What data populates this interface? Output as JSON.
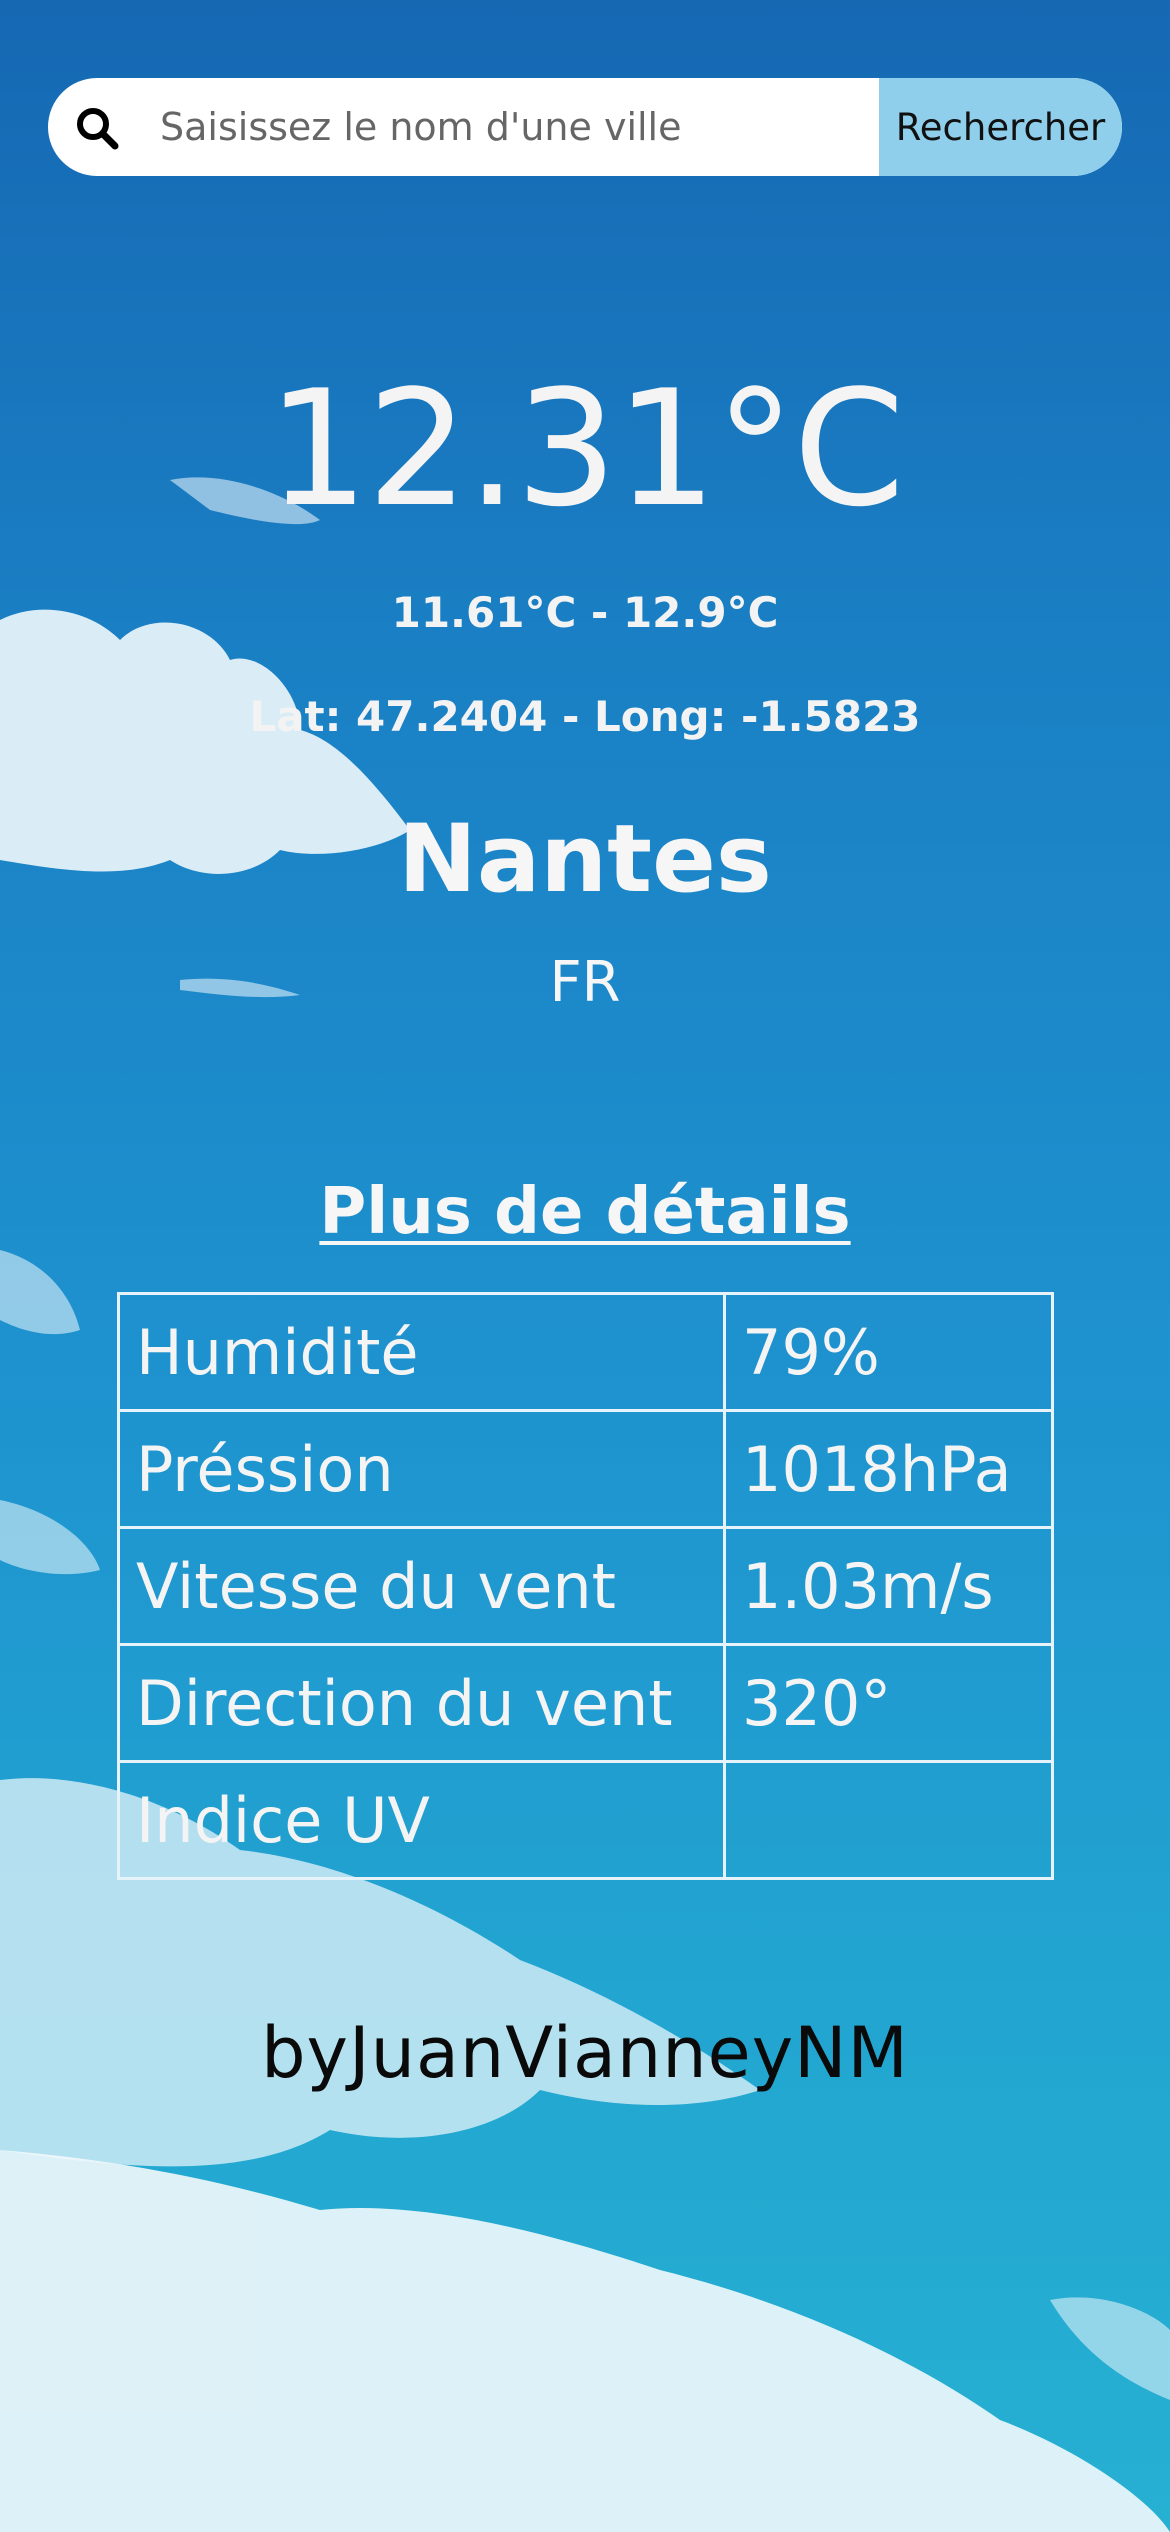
{
  "search": {
    "placeholder": "Saisissez le nom d'une ville",
    "value": "",
    "button_label": "Rechercher",
    "icon": "search-icon"
  },
  "weather": {
    "temperature": "12.31°C",
    "minmax": "11.61°C - 12.9°C",
    "coords": "Lat: 47.2404 - Long: -1.5823",
    "city": "Nantes",
    "country": "FR"
  },
  "details": {
    "title": "Plus de détails",
    "rows": [
      {
        "label": "Humidité",
        "value": "79%"
      },
      {
        "label": "Préssion",
        "value": "1018hPa"
      },
      {
        "label": "Vitesse du vent",
        "value": "1.03m/s"
      },
      {
        "label": "Direction du vent",
        "value": "320°"
      },
      {
        "label": "Indice UV",
        "value": ""
      }
    ]
  },
  "footer": {
    "credit": "byJuanVianneyNM"
  },
  "colors": {
    "sky_top": "#1668b3",
    "sky_bottom": "#26b0d2",
    "search_button": "#8fcfec",
    "text": "#ffffff",
    "credit_text": "#0a0a0a"
  }
}
